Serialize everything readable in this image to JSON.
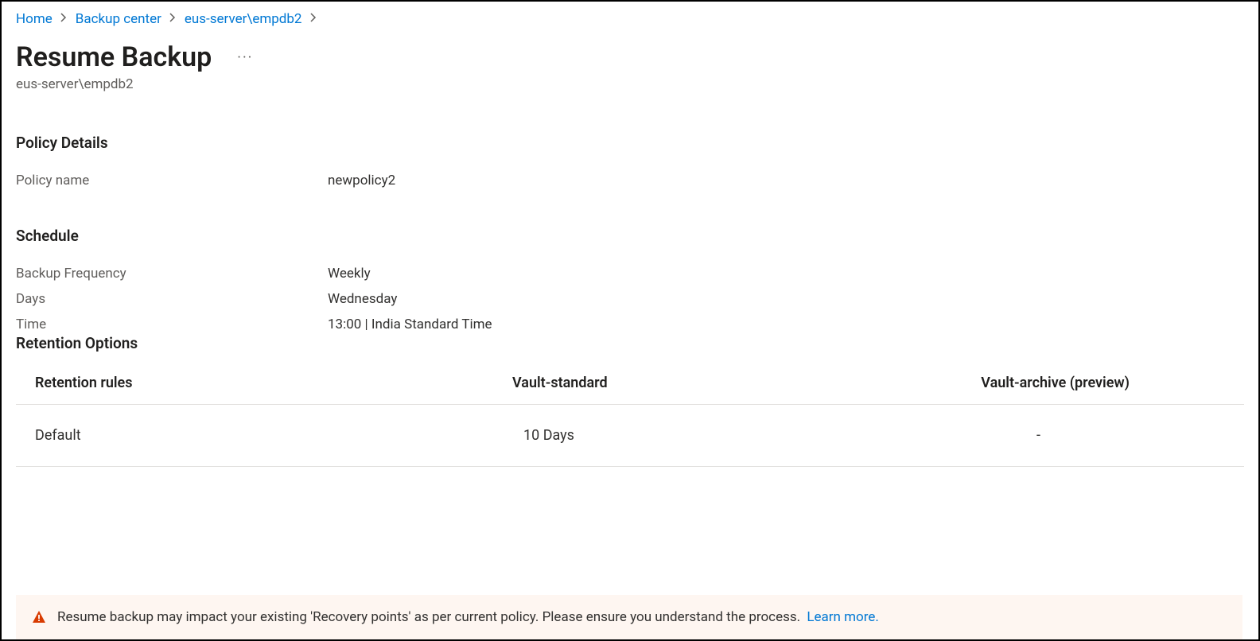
{
  "breadcrumb": {
    "items": [
      {
        "label": "Home"
      },
      {
        "label": "Backup center"
      },
      {
        "label": "eus-server\\empdb2"
      }
    ]
  },
  "header": {
    "title": "Resume Backup",
    "subtitle": "eus-server\\empdb2"
  },
  "policy_details": {
    "heading": "Policy Details",
    "name_label": "Policy name",
    "name_value": "newpolicy2"
  },
  "schedule": {
    "heading": "Schedule",
    "frequency_label": "Backup Frequency",
    "frequency_value": "Weekly",
    "days_label": "Days",
    "days_value": "Wednesday",
    "time_label": "Time",
    "time_value": "13:00 | India Standard Time"
  },
  "retention": {
    "heading": "Retention Options",
    "columns": {
      "rules": "Retention rules",
      "standard": "Vault-standard",
      "archive": "Vault-archive (preview)"
    },
    "rows": [
      {
        "rule": "Default",
        "standard": "10 Days",
        "archive": "-"
      }
    ]
  },
  "warning": {
    "text": "Resume backup may impact your existing 'Recovery points' as per current policy. Please ensure you understand the process.",
    "link": "Learn more."
  }
}
